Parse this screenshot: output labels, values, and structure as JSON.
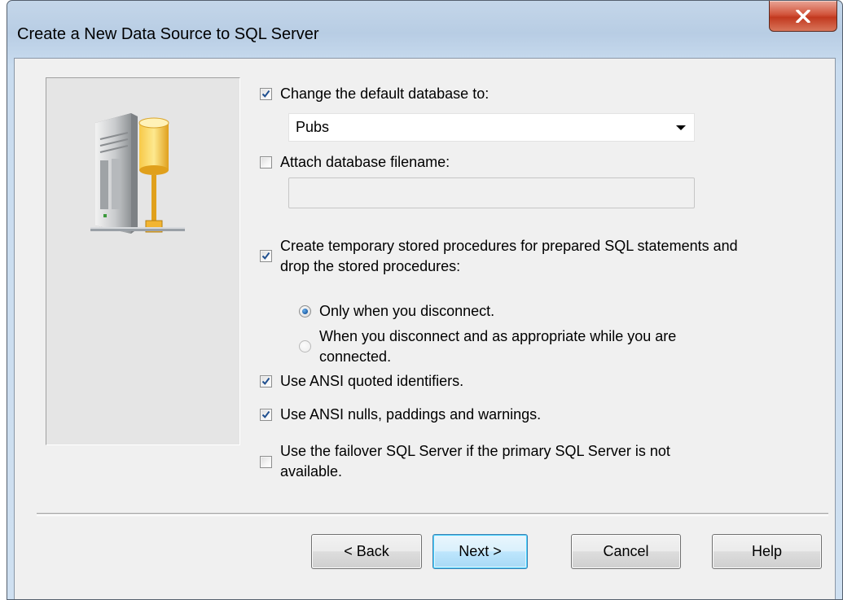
{
  "window": {
    "title": "Create a New Data Source to SQL Server"
  },
  "options": {
    "change_default_db": {
      "label": "Change the default database to:",
      "checked": true
    },
    "default_db": {
      "value": "Pubs"
    },
    "attach_db_filename": {
      "label": "Attach database filename:",
      "checked": false,
      "value": ""
    },
    "create_temp_procs": {
      "label_line1": "Create temporary stored procedures for prepared SQL statements and",
      "label_line2": "drop the stored procedures:",
      "checked": true
    },
    "radio_only_disconnect": {
      "label": "Only when you disconnect.",
      "selected": true
    },
    "radio_disconnect_appropriate": {
      "label_line1": "When you disconnect and as appropriate while you are",
      "label_line2": "connected.",
      "selected": false
    },
    "ansi_quoted": {
      "label": "Use ANSI quoted identifiers.",
      "checked": true
    },
    "ansi_nulls": {
      "label": "Use ANSI nulls, paddings and warnings.",
      "checked": true
    },
    "failover": {
      "label_line1": "Use the failover SQL Server if the primary SQL Server is not",
      "label_line2": "available.",
      "checked": false
    }
  },
  "buttons": {
    "back": "< Back",
    "next": "Next >",
    "cancel": "Cancel",
    "help": "Help"
  },
  "icons": {
    "close": "close-icon",
    "server": "database-server-icon",
    "checkmark": "checkmark-icon",
    "dropdown": "chevron-down-icon"
  },
  "colors": {
    "title_bar": "#b8cde4",
    "close_button": "#c2391f",
    "dialog_background": "#f0f0f0",
    "checkmark": "#1f4f8f",
    "default_button_border": "#3c7fb1"
  }
}
